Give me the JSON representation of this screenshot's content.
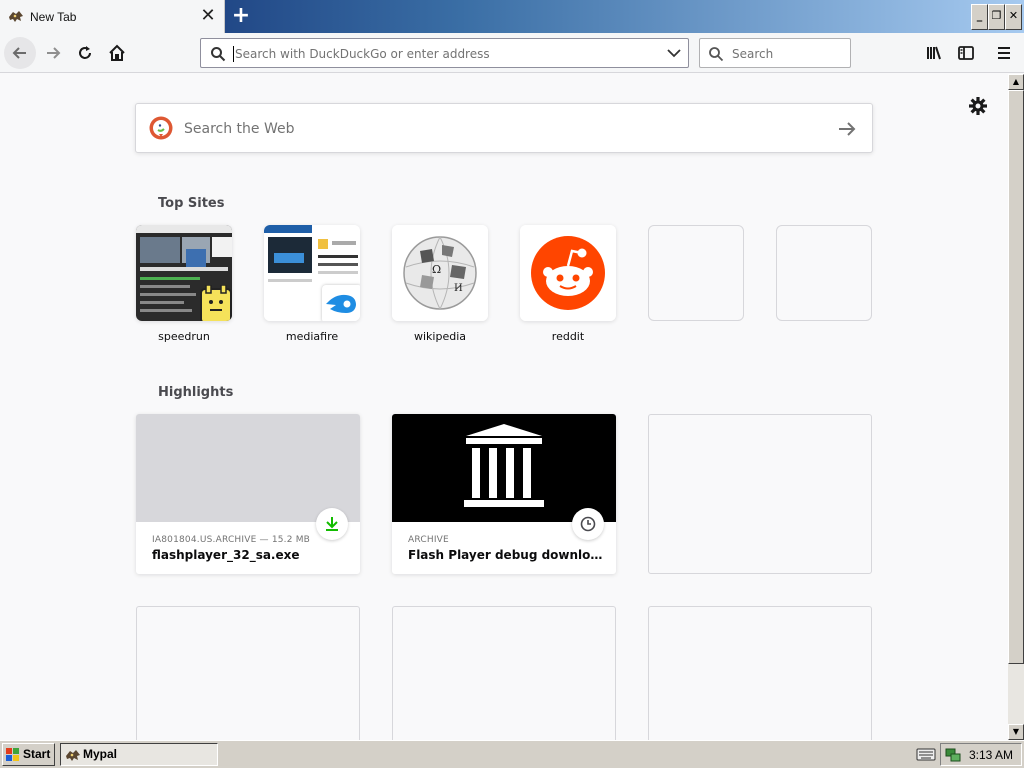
{
  "browser": {
    "tab": {
      "title": "New Tab",
      "favicon": "mypal-favicon-icon"
    },
    "new_tab_symbol": "+",
    "window_controls": [
      "_",
      "❐",
      "✕"
    ],
    "url_placeholder": "Search with DuckDuckGo or enter address",
    "search_placeholder": "Search"
  },
  "newtab": {
    "web_search_placeholder": "Search the Web",
    "top_sites_heading": "Top Sites",
    "top_sites": [
      {
        "label": "speedrun"
      },
      {
        "label": "mediafire"
      },
      {
        "label": "wikipedia"
      },
      {
        "label": "reddit"
      }
    ],
    "highlights_heading": "Highlights",
    "highlights": [
      {
        "context": "IA801804.US.ARCHIVE — 15.2 MB",
        "title": "flashplayer_32_sa.exe",
        "badge": "download-icon"
      },
      {
        "context": "ARCHIVE",
        "title": "Flash Player debug downloads - E...",
        "badge": "clock-icon"
      }
    ]
  },
  "taskbar": {
    "start_label": "Start",
    "task_label": "Mypal",
    "clock": "3:13 AM"
  },
  "colors": {
    "reddit": "#ff4500",
    "download_green": "#12bc00",
    "duckduckgo": "#de5833"
  }
}
